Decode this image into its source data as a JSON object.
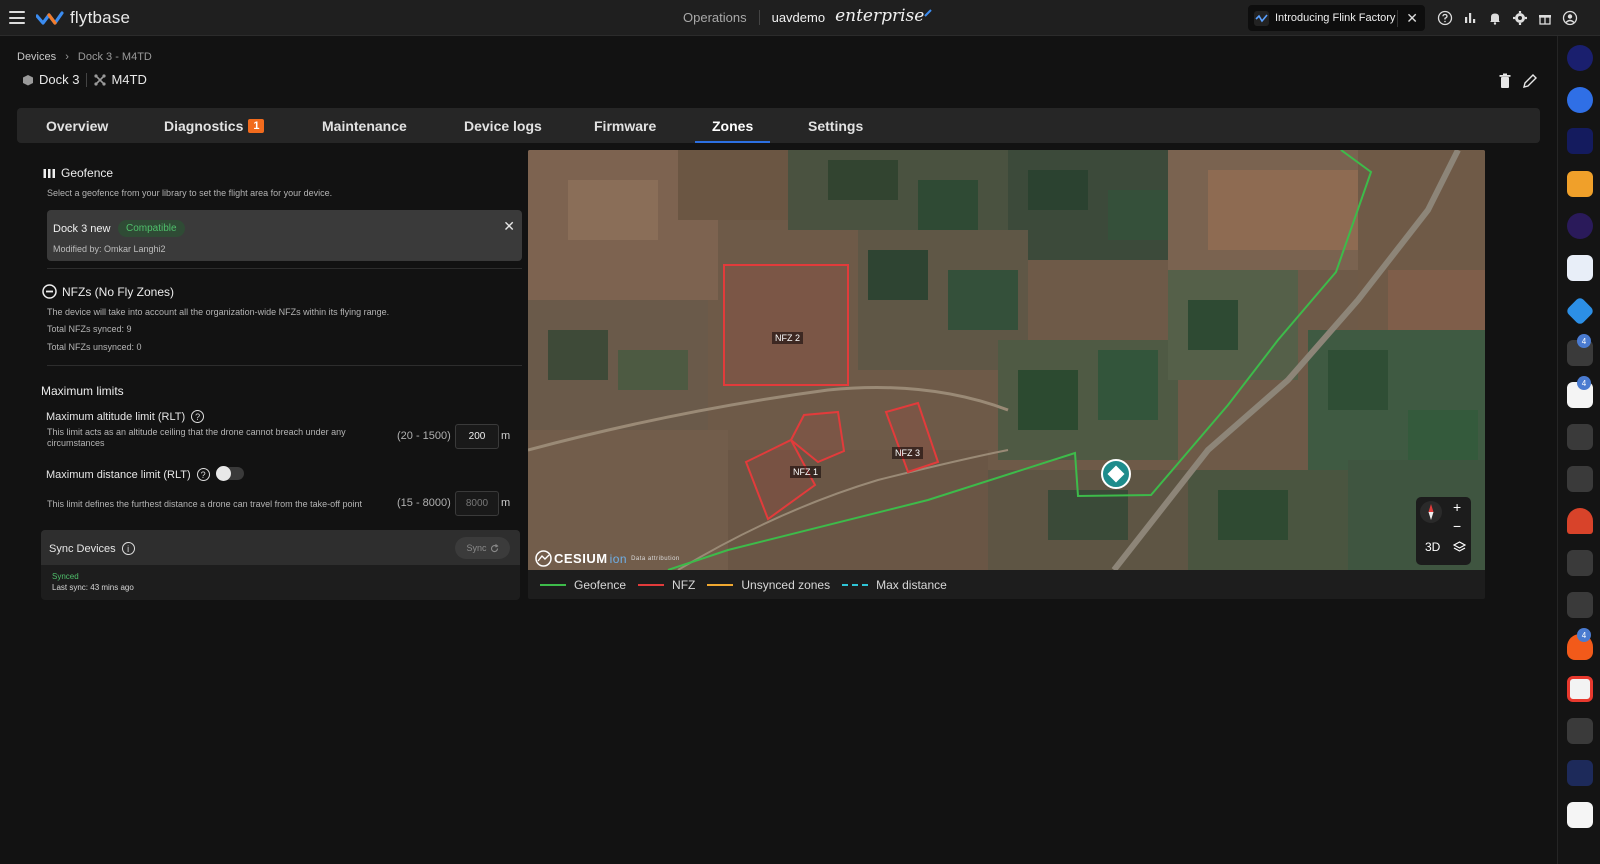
{
  "topbar": {
    "logo_text": "flytbase",
    "operations": "Operations",
    "org": "uavdemo",
    "edition": "enterprise",
    "announcement": "Introducing Flink Factory",
    "close_glyph": "✕",
    "icons": [
      "help-icon",
      "analytics-icon",
      "bell-icon",
      "gear-icon",
      "gift-icon",
      "account-icon"
    ]
  },
  "breadcrumb": {
    "root": "Devices",
    "separator": "›",
    "current": "Dock 3 - M4TD"
  },
  "device": {
    "dock": "Dock 3",
    "drone": "M4TD"
  },
  "tabs": [
    {
      "label": "Overview"
    },
    {
      "label": "Diagnostics",
      "count": "1"
    },
    {
      "label": "Maintenance"
    },
    {
      "label": "Device logs"
    },
    {
      "label": "Firmware"
    },
    {
      "label": "Zones",
      "active": true
    },
    {
      "label": "Settings"
    }
  ],
  "geofence": {
    "title": "Geofence",
    "description": "Select a geofence from your library to set the flight area for your device.",
    "selected_name": "Dock 3 new",
    "status": "Compatible",
    "modified_by": "Modified by: Omkar Langhi2",
    "remove_glyph": "✕"
  },
  "nfz": {
    "title": "NFZs (No Fly Zones)",
    "description": "The device will take into account all the organization-wide NFZs within its flying range.",
    "synced": "Total NFZs synced: 9",
    "unsynced": "Total NFZs unsynced: 0"
  },
  "limits": {
    "title": "Maximum limits",
    "altitude": {
      "label": "Maximum altitude limit (RLT)",
      "description_line1": "This limit acts as an altitude ceiling that the drone cannot breach under any",
      "description_line2": "circumstances",
      "range": "(20 - 1500)",
      "value": "200",
      "unit": "m"
    },
    "distance": {
      "label": "Maximum distance limit (RLT)",
      "description": "This limit defines the furthest distance a drone can travel from the take-off point",
      "range": "(15 - 8000)",
      "value": "8000",
      "unit": "m",
      "enabled": false
    }
  },
  "sync": {
    "title": "Sync Devices",
    "button": "Sync",
    "status": "Synced",
    "last_sync": "Last sync: 43 mins ago"
  },
  "map": {
    "zones": [
      "NFZ 2",
      "NFZ 1",
      "NFZ 3"
    ],
    "attribution_logo": "CESIUM",
    "attribution_suffix": "ion",
    "attribution_link": "Data attribution",
    "controls": {
      "zoom_in": "+",
      "zoom_out": "−",
      "mode": "3D"
    },
    "colors": {
      "geofence": "#3dbb4a",
      "nfz": "#e23b3b",
      "unsynced": "#f0a830",
      "max_distance": "#2fc4d6"
    },
    "legend": [
      "Geofence",
      "NFZ",
      "Unsynced zones",
      "Max distance"
    ]
  },
  "right_rail": {
    "apps": [
      "app-icon",
      "app-icon",
      "app-icon",
      "app-icon",
      "app-icon",
      "genetec-icon",
      "app-icon",
      "app-icon",
      "alarm-icon",
      "app-icon",
      "siren-icon",
      "app-icon",
      "app-icon",
      "fire-icon",
      "camera-icon",
      "app-icon",
      "app-icon",
      "app-icon"
    ],
    "badges": [
      "4",
      "4",
      "4"
    ]
  }
}
